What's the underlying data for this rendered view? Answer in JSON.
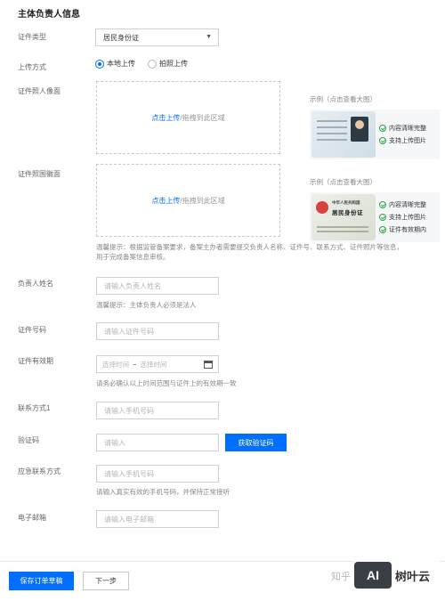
{
  "section": {
    "title": "主体负责人信息"
  },
  "cert_type": {
    "label": "证件类型",
    "value": "居民身份证"
  },
  "upload_method": {
    "label": "上传方式",
    "options": [
      "本地上传",
      "拍照上传"
    ]
  },
  "front_photo": {
    "label": "证件照人像面",
    "upload_link": "点击上传",
    "upload_hint": "/拖拽到此区域",
    "example_title": "示例（点击查看大图）",
    "checks": [
      "内容清晰完整",
      "支持上传图片"
    ]
  },
  "back_photo": {
    "label": "证件照国徽面",
    "upload_link": "点击上传",
    "upload_hint": "/拖拽到此区域",
    "example_title": "示例（点击查看大图）",
    "card_title1": "中华人民共和国",
    "card_title2": "居民身份证",
    "checks": [
      "内容清晰完整",
      "支持上传图片",
      "证件有效期内"
    ]
  },
  "upload_tip": "温馨提示：根据监管备案要求，备案主办者需要提交负责人名称、证件号、联系方式、证件照片等信息，用于完成备案信息审核。",
  "owner_name": {
    "label": "负责人姓名",
    "placeholder": "请输入负责人姓名",
    "tip": "温馨提示：主体负责人必须是法人"
  },
  "cert_number": {
    "label": "证件号码",
    "placeholder": "请输入证件号码"
  },
  "cert_validity": {
    "label": "证件有效期",
    "start": "选择时间",
    "sep": "~",
    "end": "选择时间",
    "tip": "请务必确认以上时间范围与证件上的有效期一致"
  },
  "contact1": {
    "label": "联系方式1",
    "placeholder": "请输入手机号码"
  },
  "verify_code": {
    "label": "验证码",
    "placeholder": "请输入",
    "button": "获取验证码"
  },
  "emergency_contact": {
    "label": "应急联系方式",
    "placeholder": "请输入手机号码",
    "tip": "请输入真实有效的手机号码，并保持正常接听"
  },
  "email": {
    "label": "电子邮箱",
    "placeholder": "请输入电子邮箱"
  },
  "footer": {
    "save": "保存订单草稿",
    "next": "下一步"
  },
  "watermark": {
    "text": "知乎",
    "brand_logo": "AI",
    "brand_name": "树叶云"
  },
  "colors": {
    "primary": "#006eff",
    "success": "#29a744"
  }
}
